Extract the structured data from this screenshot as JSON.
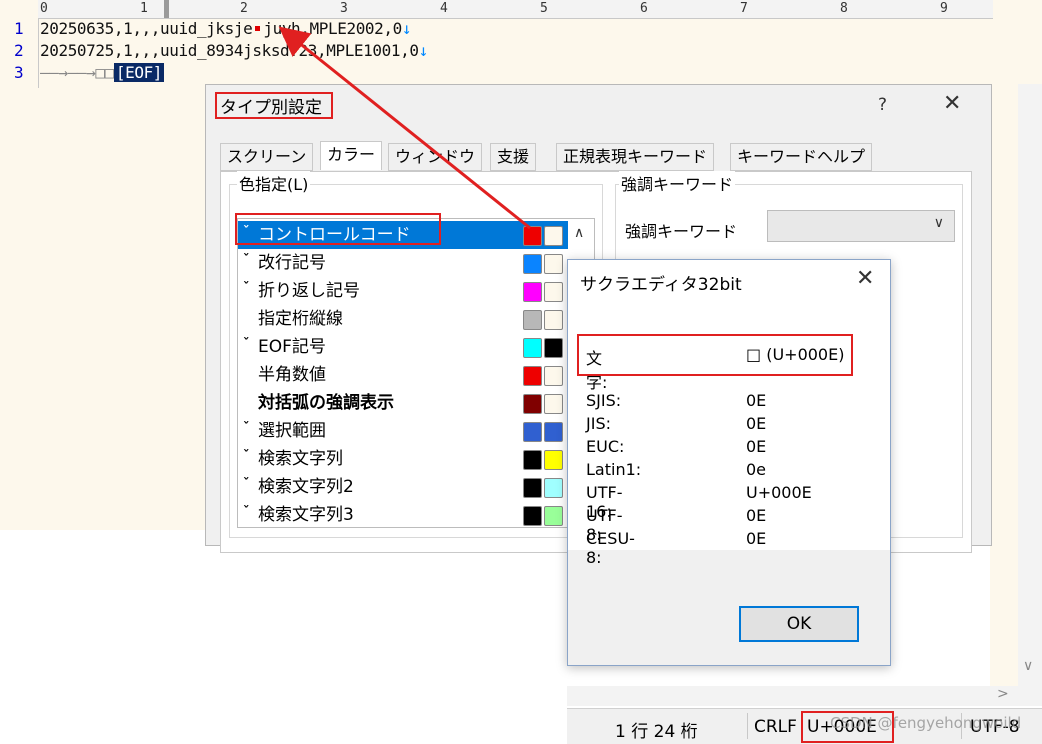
{
  "editor": {
    "ruler": [
      "0",
      "1",
      "2",
      "3",
      "4",
      "5",
      "6",
      "7",
      "8",
      "9"
    ],
    "lines": [
      {
        "num": "1",
        "before": "20250635,1,,,uuid_jksje",
        "after": "juyh,MPLE2002,0",
        "eol": "↓"
      },
      {
        "num": "2",
        "text": "20250725,1,,,uuid_8934jsk",
        "hidden_tail": "sdf23,MPLE1001,0",
        "eol": "↓"
      },
      {
        "num": "3",
        "marks": "——→——→□□",
        "eof": "[EOF]"
      }
    ]
  },
  "type_settings": {
    "title": "タイプ別設定",
    "help": "?",
    "close": "✕",
    "tabs": [
      "スクリーン",
      "カラー",
      "ウィンドウ",
      "支援",
      "正規表現キーワード",
      "キーワードヘルプ"
    ],
    "color_group_label": "色指定(L)",
    "color_items": [
      {
        "label": "コントロールコード",
        "checked": true,
        "bold": false,
        "fg": "#ee0000",
        "bg": "#fdf8ec"
      },
      {
        "label": "改行記号",
        "checked": true,
        "bold": false,
        "fg": "#0a84ff",
        "bg": "#fdf8ec"
      },
      {
        "label": "折り返し記号",
        "checked": true,
        "bold": false,
        "fg": "#ff00ff",
        "bg": "#fdf8ec"
      },
      {
        "label": "指定桁縦線",
        "checked": false,
        "bold": false,
        "fg": "#b8b8b8",
        "bg": "#fdf8ec"
      },
      {
        "label": "EOF記号",
        "checked": true,
        "bold": false,
        "fg": "#00ffff",
        "bg": "#000000"
      },
      {
        "label": "半角数値",
        "checked": false,
        "bold": false,
        "fg": "#ee0000",
        "bg": "#fdf8ec"
      },
      {
        "label": "対括弧の強調表示",
        "checked": false,
        "bold": true,
        "fg": "#800000",
        "bg": "#fdf8ec"
      },
      {
        "label": "選択範囲",
        "checked": true,
        "bold": false,
        "fg": "#3060d0",
        "bg": "#3060d0"
      },
      {
        "label": "検索文字列",
        "checked": true,
        "bold": false,
        "fg": "#000000",
        "bg": "#ffff00"
      },
      {
        "label": "検索文字列2",
        "checked": true,
        "bold": false,
        "fg": "#000000",
        "bg": "#a0ffff"
      },
      {
        "label": "検索文字列3",
        "checked": true,
        "bold": false,
        "fg": "#000000",
        "bg": "#99ff99"
      }
    ],
    "keyword_group_label": "強調キーワード",
    "keyword_label": "強調キーワード",
    "keyword_value": ""
  },
  "char_dialog": {
    "title": "サクラエディタ32bit",
    "close": "✕",
    "char_label": "文字:",
    "char_value": "□ (U+000E)",
    "codes": [
      {
        "k": "SJIS:",
        "v": "0E"
      },
      {
        "k": "JIS:",
        "v": "0E"
      },
      {
        "k": "EUC:",
        "v": "0E"
      },
      {
        "k": "Latin1:",
        "v": "0e"
      },
      {
        "k": "UTF-16:",
        "v": "U+000E"
      },
      {
        "k": "UTF-8:",
        "v": "0E"
      },
      {
        "k": "CESU-8:",
        "v": "0E"
      }
    ],
    "ok": "OK"
  },
  "status": {
    "position": "1 行  24 桁",
    "eol": "CRLF",
    "code": "U+000E",
    "encoding": "UTF-8",
    "watermark": "CSDN @fengyehongwoild"
  },
  "colors": {
    "highlight_box": "#e02020",
    "arrow": "#e02020",
    "selection": "#0078d7"
  }
}
